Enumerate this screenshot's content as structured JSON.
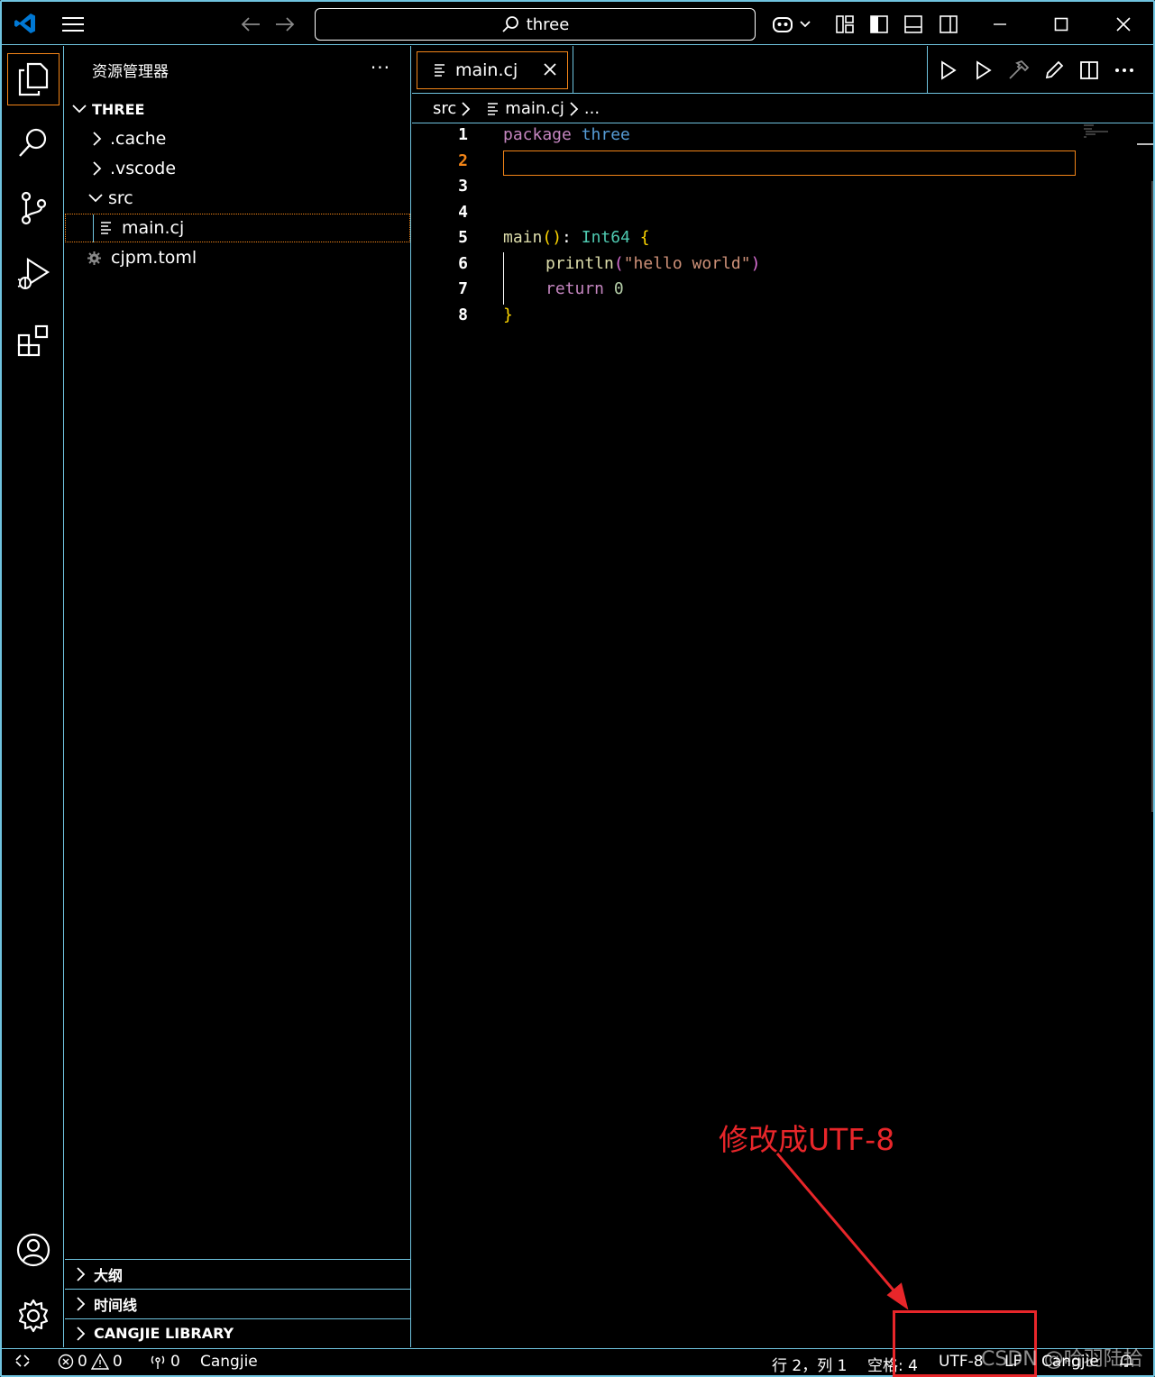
{
  "titlebar": {
    "search_text": "three"
  },
  "sidebar": {
    "title": "资源管理器",
    "more": "···",
    "root": "THREE",
    "items": [
      {
        "label": ".cache"
      },
      {
        "label": ".vscode"
      },
      {
        "label": "src"
      },
      {
        "label": "main.cj"
      },
      {
        "label": "cjpm.toml"
      }
    ],
    "sections": [
      {
        "label": "大纲"
      },
      {
        "label": "时间线"
      },
      {
        "label": "CANGJIE LIBRARY"
      }
    ]
  },
  "editor": {
    "tab_label": "main.cj",
    "breadcrumb": {
      "folder": "src",
      "file": "main.cj",
      "rest": "..."
    },
    "line_numbers": [
      "1",
      "2",
      "3",
      "4",
      "5",
      "6",
      "7",
      "8"
    ],
    "code": {
      "l1_kw": "package",
      "l1_name": "three",
      "l5_fn": "main",
      "l5_parens": "()",
      "l5_colon": ": ",
      "l5_type": "Int64",
      "l5_brace": "{",
      "l6_fn": "println",
      "l6_open": "(",
      "l6_str": "\"hello world\"",
      "l6_close": ")",
      "l7_kw": "return",
      "l7_num": "0",
      "l8_brace": "}"
    }
  },
  "statusbar": {
    "errors": "0",
    "warnings": "0",
    "ports": "0",
    "language_mode": "Cangjie",
    "position": "行 2，列 1",
    "indent": "空格: 4",
    "encoding": "UTF-8",
    "eol": "LF",
    "language": "Cangjie"
  },
  "annotation": {
    "text": "修改成UTF-8",
    "color": "#e8262a"
  },
  "watermark": "CSDN @哈羽陆拾",
  "colors": {
    "border": "#6fc3df",
    "focus": "#f38518",
    "accent_logo": "#0078d4"
  }
}
